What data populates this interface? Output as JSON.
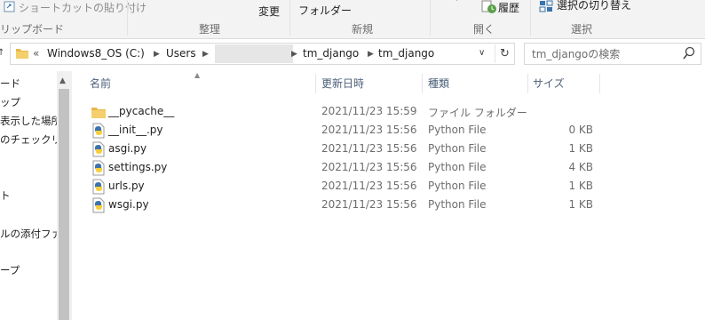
{
  "ribbon": {
    "clipboard_shortcut": "ショートカットの貼り付け",
    "clipboard_group": "リップボード",
    "organize_line": "変更",
    "organize_group": "整理",
    "new_folder": "フォルダー",
    "new_group": "新規",
    "history": "履歴",
    "open_group": "開く",
    "toggle_selection": "選択の切り替え",
    "select_group": "選択"
  },
  "address": {
    "overflow": "«",
    "drive": "Windows8_OS (C:)",
    "users": "Users",
    "folder1": "tm_django",
    "folder2": "tm_django"
  },
  "search": {
    "placeholder": "tm_djangoの検索"
  },
  "nav": {
    "items": [
      "ード",
      "ップ",
      "表示した場所",
      "のチェックリスト",
      "ト",
      "ルの添付ファイ",
      "ープ"
    ]
  },
  "columns": {
    "name": "名前",
    "date": "更新日時",
    "type": "種類",
    "size": "サイズ"
  },
  "files": [
    {
      "name": "__pycache__",
      "date": "2021/11/23 15:59",
      "type": "ファイル フォルダー",
      "size": "",
      "icon": "folder-icon"
    },
    {
      "name": "__init__.py",
      "date": "2021/11/23 15:56",
      "type": "Python File",
      "size": "0 KB",
      "icon": "python-file-icon"
    },
    {
      "name": "asgi.py",
      "date": "2021/11/23 15:56",
      "type": "Python File",
      "size": "1 KB",
      "icon": "python-file-icon"
    },
    {
      "name": "settings.py",
      "date": "2021/11/23 15:56",
      "type": "Python File",
      "size": "4 KB",
      "icon": "python-file-icon"
    },
    {
      "name": "urls.py",
      "date": "2021/11/23 15:56",
      "type": "Python File",
      "size": "1 KB",
      "icon": "python-file-icon"
    },
    {
      "name": "wsgi.py",
      "date": "2021/11/23 15:56",
      "type": "Python File",
      "size": "1 KB",
      "icon": "python-file-icon"
    }
  ],
  "colors": {
    "header_text": "#4c607a",
    "folder": "#e8b84a",
    "python_blue": "#3a73ad",
    "python_yellow": "#f7cf3e"
  }
}
